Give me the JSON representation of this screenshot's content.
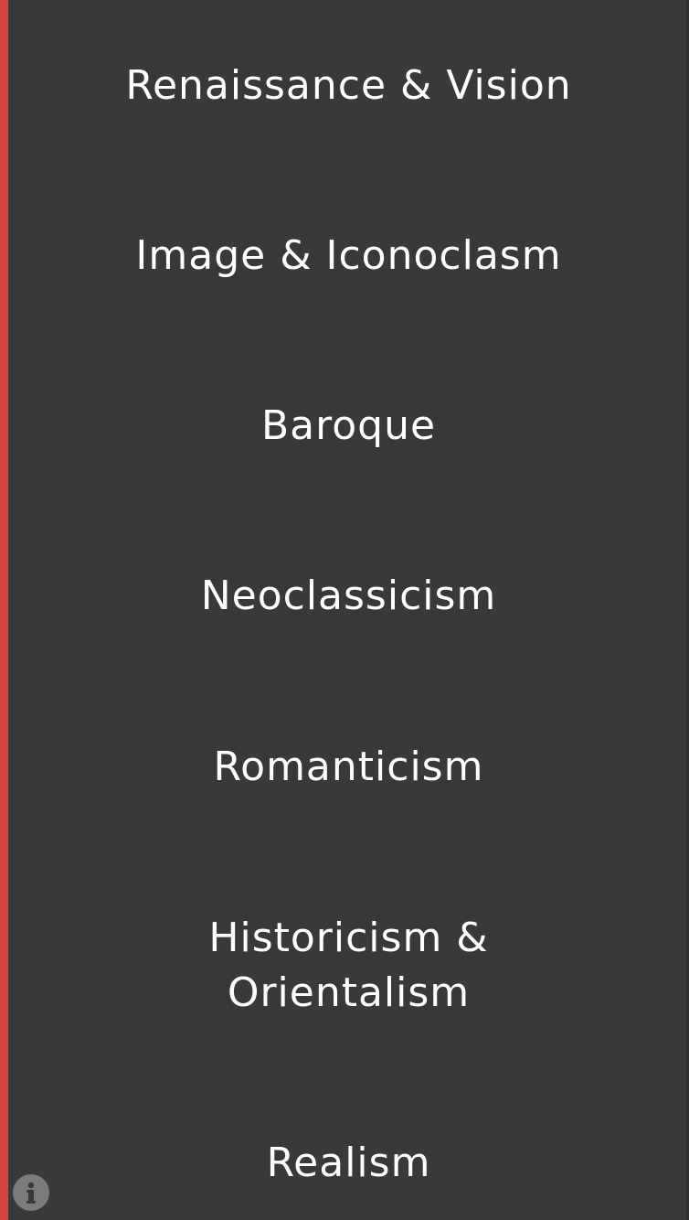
{
  "menu": {
    "items": [
      {
        "label": "Renaissance & Vision"
      },
      {
        "label": "Image & Iconoclasm"
      },
      {
        "label": "Baroque"
      },
      {
        "label": "Neoclassicism"
      },
      {
        "label": "Romanticism"
      },
      {
        "label": "Historicism & Orientalism",
        "lines": [
          "Historicism &",
          "Orientalism"
        ]
      },
      {
        "label": "Realism"
      }
    ]
  },
  "info_button": {
    "icon": "info-icon"
  },
  "colors": {
    "background": "#38393b",
    "accent": "#d64545",
    "text": "#ffffff",
    "info_icon": "#7a7b7d"
  }
}
